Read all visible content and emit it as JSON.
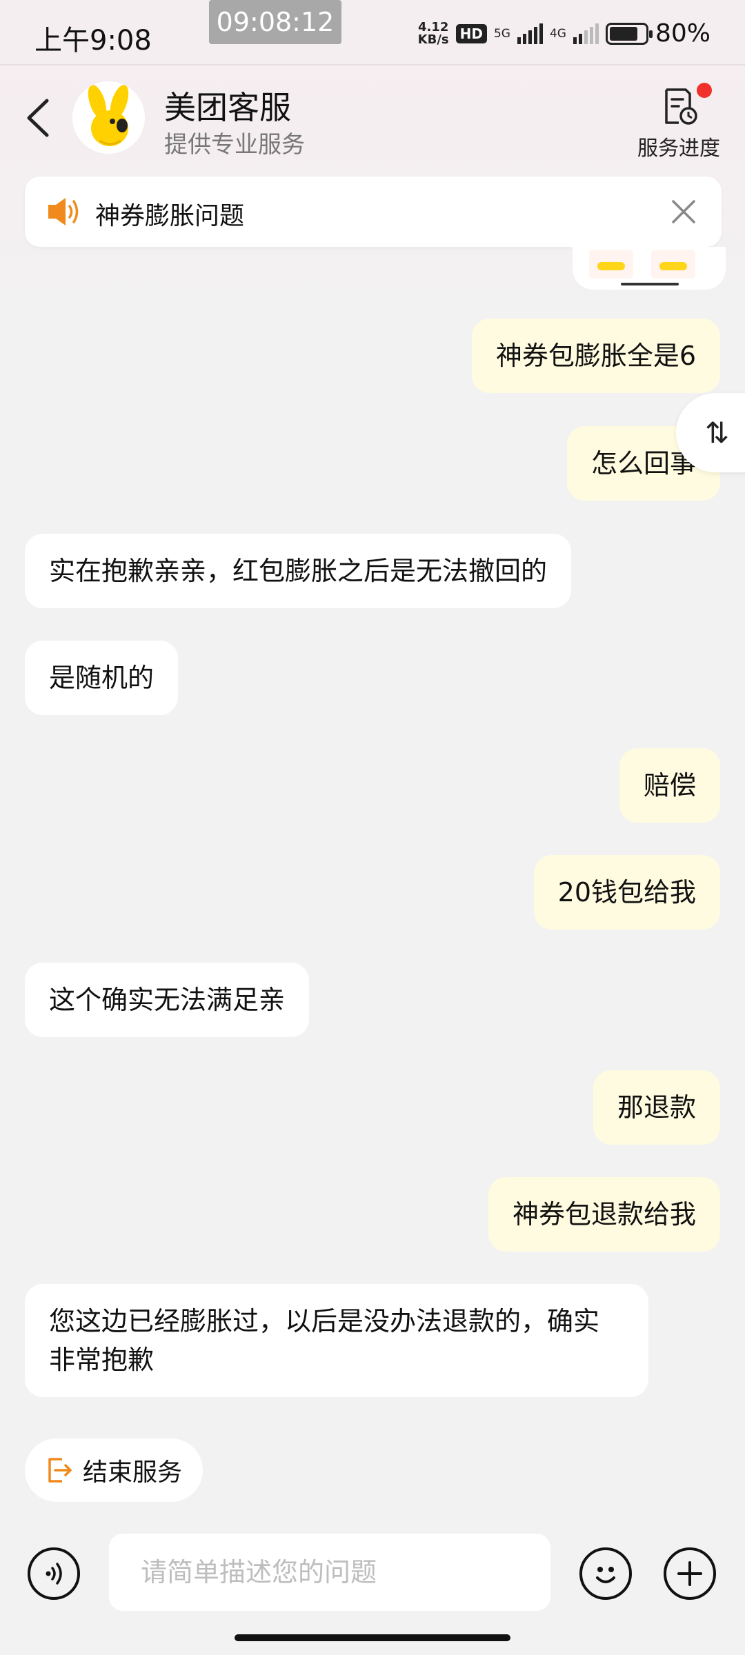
{
  "status_bar": {
    "time": "上午9:08",
    "clock_overlay": "09:08:12",
    "speed_value": "4.12",
    "speed_unit": "KB/s",
    "hd": "HD",
    "net_5g": "5G",
    "net_4g": "4G",
    "battery_pct": "80%",
    "battery_level": 0.8
  },
  "header": {
    "title": "美团客服",
    "subtitle": "提供专业服务",
    "progress_label": "服务进度",
    "back_icon": "chevron-left-icon"
  },
  "notice": {
    "text": "神券膨胀问题",
    "icon": "speaker-icon"
  },
  "messages": [
    {
      "side": "me",
      "text": "神券包膨胀全是6"
    },
    {
      "side": "me",
      "text": "怎么回事"
    },
    {
      "side": "them",
      "text": "实在抱歉亲亲，红包膨胀之后是无法撤回的"
    },
    {
      "side": "them",
      "text": "是随机的"
    },
    {
      "side": "me",
      "text": "赔偿"
    },
    {
      "side": "me",
      "text": "20钱包给我"
    },
    {
      "side": "them",
      "text": "这个确实无法满足亲"
    },
    {
      "side": "me",
      "text": "那退款"
    },
    {
      "side": "me",
      "text": "神券包退款给我"
    },
    {
      "side": "them",
      "text": "您这边已经膨胀过，以后是没办法退款的，确实非常抱歉"
    }
  ],
  "scroll_tab_glyph": "⇅",
  "end_service": {
    "label": "结束服务"
  },
  "input": {
    "placeholder": "请简单描述您的问题",
    "value": ""
  },
  "colors": {
    "my_bubble": "#fffbe0",
    "their_bubble": "#ffffff",
    "accent_orange": "#f08a1c",
    "red_dot": "#f0312c",
    "background": "#f2f2f2"
  }
}
